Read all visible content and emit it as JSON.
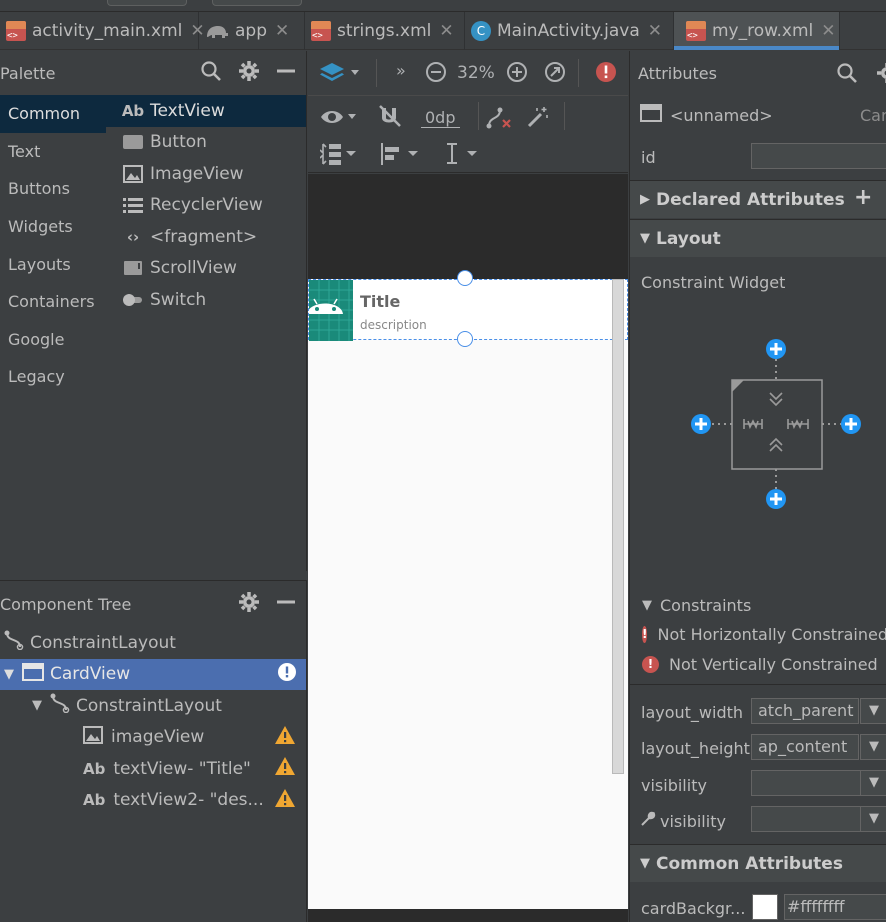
{
  "tabs": [
    {
      "label": "activity_main.xml",
      "icon": "xml-file-icon",
      "active": false
    },
    {
      "label": "app",
      "icon": "gradle-elephant-icon",
      "active": false
    },
    {
      "label": "strings.xml",
      "icon": "xml-file-icon",
      "active": false
    },
    {
      "label": "MainActivity.java",
      "icon": "java-class-icon",
      "active": false
    },
    {
      "label": "my_row.xml",
      "icon": "xml-file-icon",
      "active": true
    }
  ],
  "palette": {
    "title": "Palette",
    "categories": [
      "Common",
      "Text",
      "Buttons",
      "Widgets",
      "Layouts",
      "Containers",
      "Google",
      "Legacy"
    ],
    "items": [
      "TextView",
      "Button",
      "ImageView",
      "RecyclerView",
      "<fragment>",
      "ScrollView",
      "Switch"
    ],
    "text_glyph": "Ab"
  },
  "tree": {
    "title": "Component Tree",
    "nodes": [
      {
        "label": "ConstraintLayout"
      },
      {
        "label": "CardView"
      },
      {
        "label": "ConstraintLayout"
      },
      {
        "label": "imageView"
      },
      {
        "label": "textView- \"Title\""
      },
      {
        "label": "textView2- \"des..."
      }
    ]
  },
  "toolbar": {
    "zoom": "32%",
    "margin": "0dp",
    "overflow": "»"
  },
  "canvas": {
    "card_title": "Title",
    "card_description": "description"
  },
  "attributes": {
    "title": "Attributes",
    "component_name": "<unnamed>",
    "component_type": "Car",
    "id_label": "id",
    "declared_header": "Declared Attributes",
    "layout_header": "Layout",
    "constraint_widget": "Constraint Widget",
    "constraints_header": "Constraints",
    "constraint_errors": [
      "Not Horizontally Constrained",
      "Not Vertically Constrained"
    ],
    "layout_width_label": "layout_width",
    "layout_width_value": "atch_parent",
    "layout_height_label": "layout_height",
    "layout_height_value": "ap_content",
    "visibility_label": "visibility",
    "tools_visibility_label": "visibility",
    "common_header": "Common Attributes",
    "card_bg_label": "cardBackgr...",
    "card_bg_value": "#ffffffff"
  },
  "colors": {
    "accent": "#4a88c7",
    "selection": "#4b6eaf",
    "error": "#c75450",
    "warning": "#f0a732",
    "constraint_blue": "#2196f3"
  }
}
